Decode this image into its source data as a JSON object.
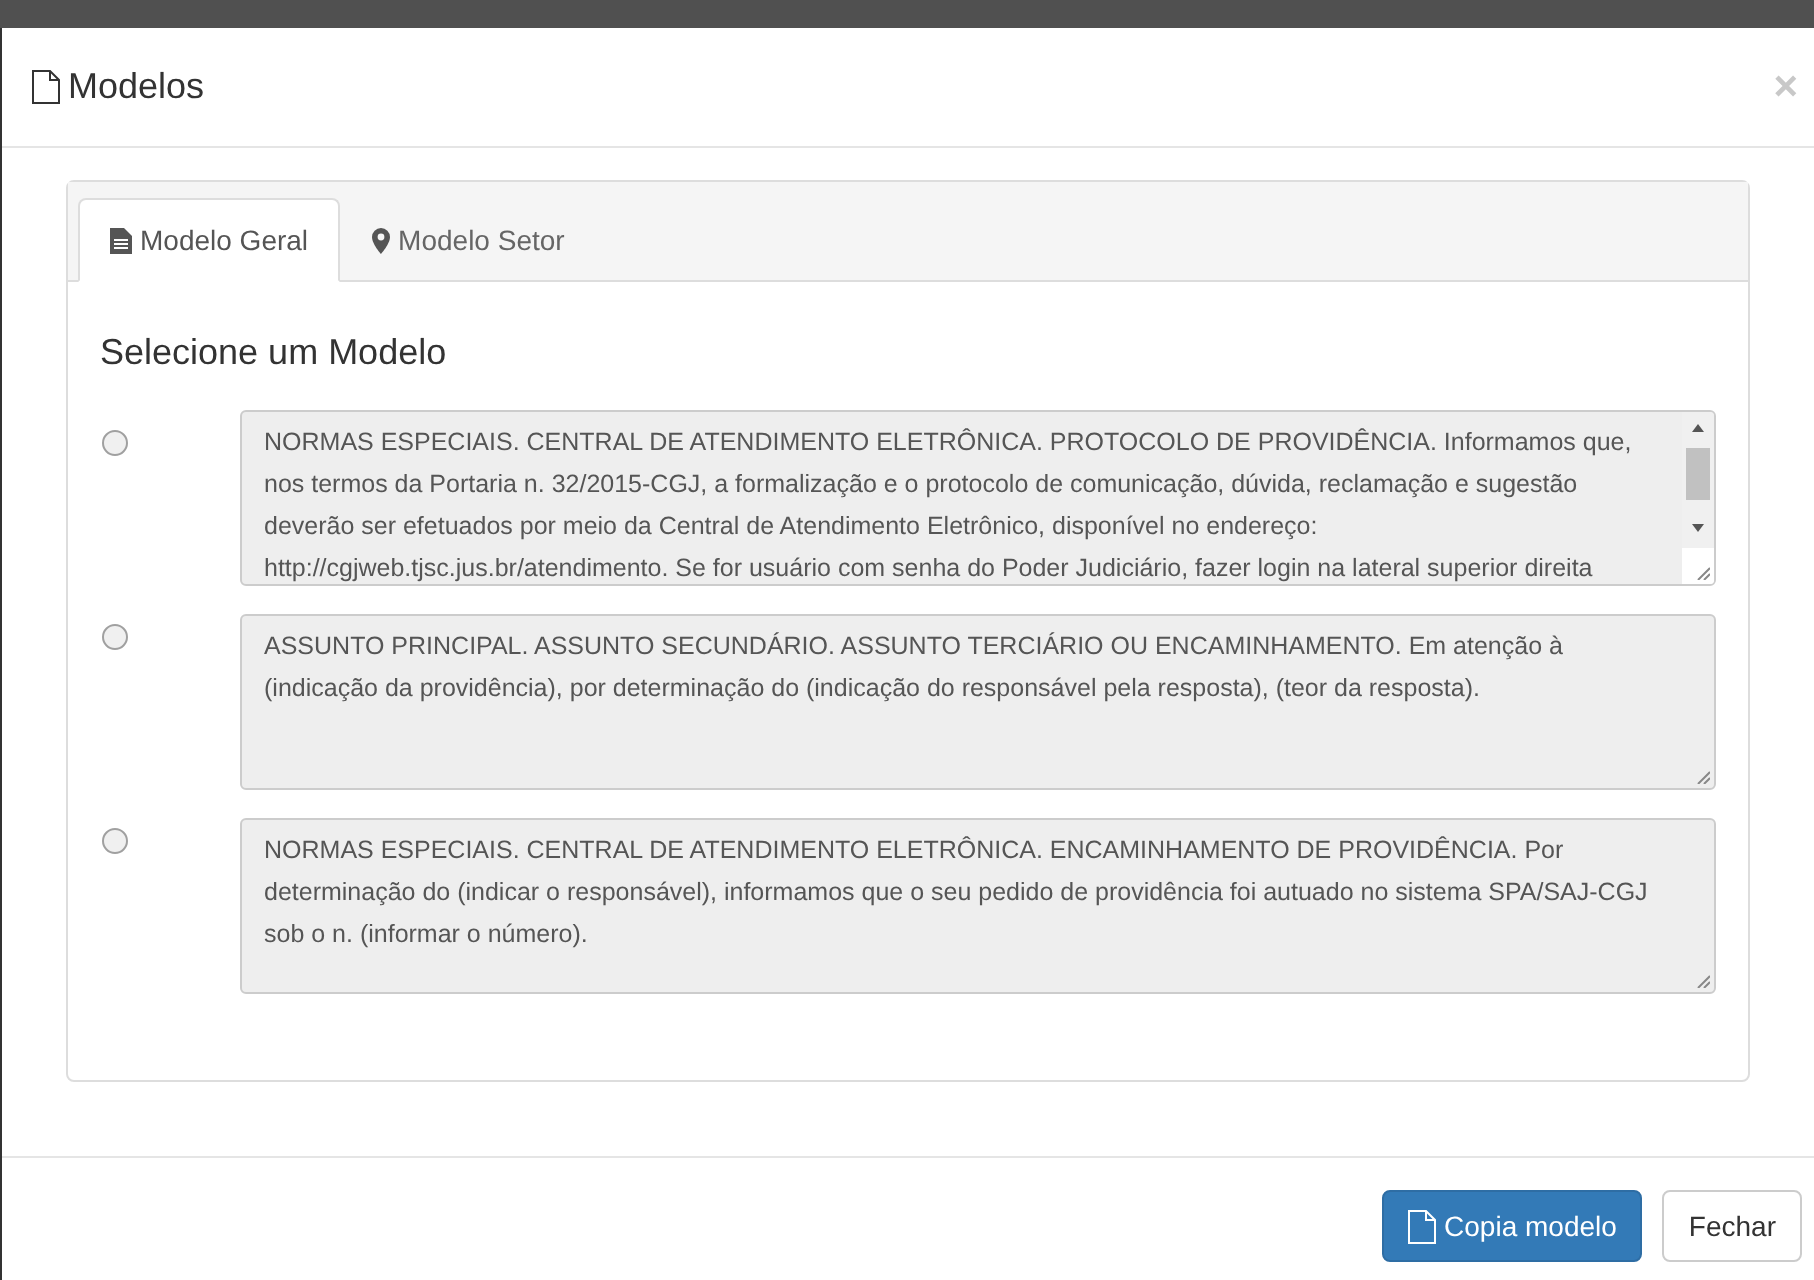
{
  "dialog": {
    "title": "Modelos",
    "close": "×"
  },
  "tabs": [
    {
      "label": "Modelo Geral",
      "kind": "document",
      "selected": true
    },
    {
      "label": "Modelo Setor",
      "kind": "pin",
      "selected": false
    }
  ],
  "heading": "Selecione um Modelo",
  "models": [
    {
      "selected": false,
      "scrollable": true,
      "text": "NORMAS ESPECIAIS. CENTRAL DE ATENDIMENTO ELETRÔNICA. PROTOCOLO DE PROVIDÊNCIA. Informamos que, nos termos da Portaria n. 32/2015-CGJ, a formalização e o protocolo de comunicação, dúvida, reclamação e sugestão deverão ser efetuados por meio da Central de Atendimento Eletrônico, disponível no endereço: http://cgjweb.tjsc.jus.br/atendimento. Se for usuário com senha do Poder Judiciário, fazer login na lateral superior direita"
    },
    {
      "selected": false,
      "scrollable": false,
      "text": "ASSUNTO PRINCIPAL. ASSUNTO SECUNDÁRIO. ASSUNTO TERCIÁRIO OU ENCAMINHAMENTO. Em atenção à (indicação da providência), por determinação do (indicação do responsável pela resposta), (teor da resposta)."
    },
    {
      "selected": false,
      "scrollable": false,
      "text": "NORMAS ESPECIAIS. CENTRAL DE ATENDIMENTO ELETRÔNICA. ENCAMINHAMENTO DE PROVIDÊNCIA. Por determinação do (indicar o responsável), informamos que o seu pedido de providência foi autuado no sistema SPA/SAJ-CGJ sob o n. (informar o número)."
    }
  ],
  "buttons": [
    {
      "label": "Copia modelo",
      "kind": "primary"
    },
    {
      "label": "Fechar",
      "kind": "default"
    }
  ]
}
